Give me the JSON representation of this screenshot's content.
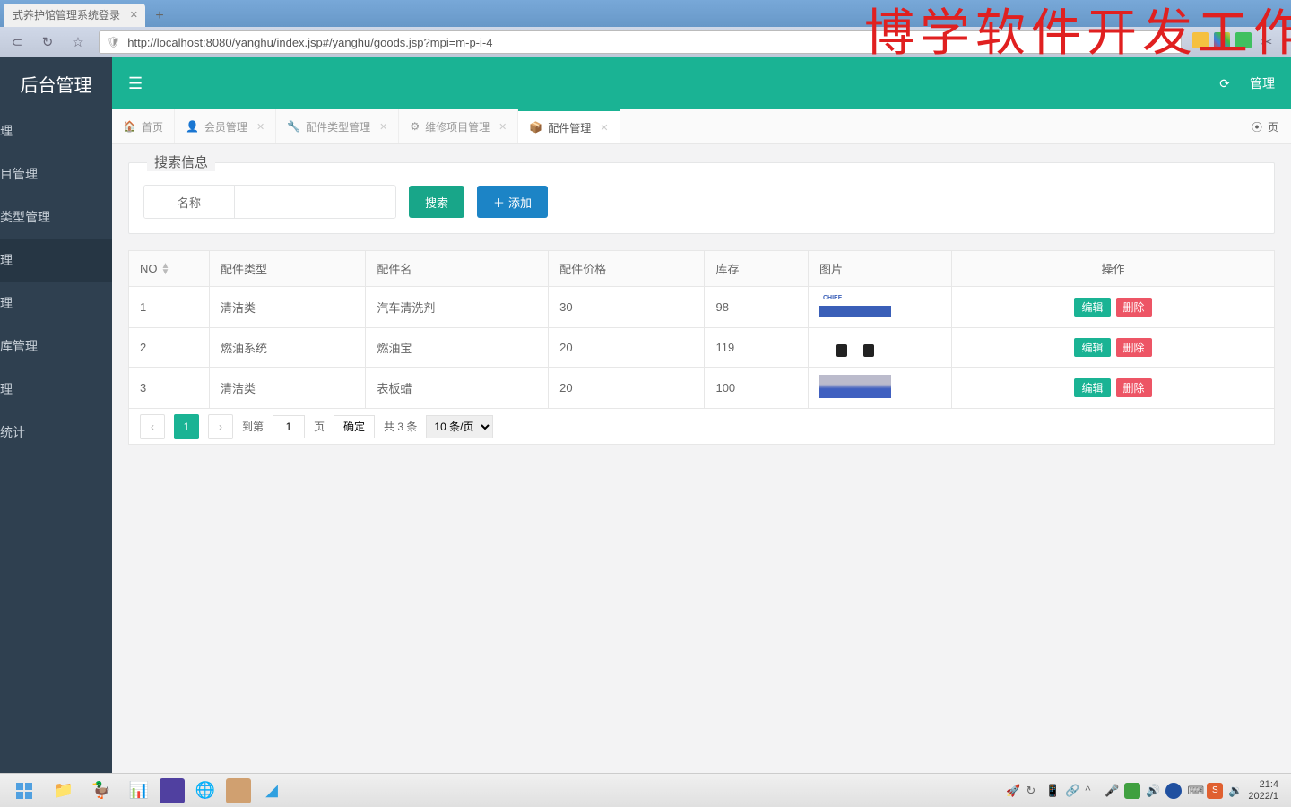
{
  "browser": {
    "tab_title": "式养护馆管理系统登录",
    "url": "http://localhost:8080/yanghu/index.jsp#/yanghu/goods.jsp?mpi=m-p-i-4"
  },
  "watermark": "博学软件开发工作",
  "sidebar": {
    "logo": "后台管理",
    "items": [
      {
        "label": "理"
      },
      {
        "label": "目管理"
      },
      {
        "label": "类型管理"
      },
      {
        "label": "理"
      },
      {
        "label": "理"
      },
      {
        "label": "库管理"
      },
      {
        "label": "理"
      },
      {
        "label": "统计"
      }
    ],
    "active": 3
  },
  "topbar": {
    "user": "管理",
    "refresh_icon": "refresh"
  },
  "tabs": [
    {
      "icon": "🏠",
      "label": "首页",
      "closable": false
    },
    {
      "icon": "👤",
      "label": "会员管理",
      "closable": true
    },
    {
      "icon": "🔧",
      "label": "配件类型管理",
      "closable": true
    },
    {
      "icon": "⚙",
      "label": "维修项目管理",
      "closable": true
    },
    {
      "icon": "📦",
      "label": "配件管理",
      "closable": true
    }
  ],
  "active_tab": 4,
  "tab_right": {
    "icon": "⦿",
    "label": "页"
  },
  "search": {
    "legend": "搜索信息",
    "name_label": "名称",
    "search_btn": "搜索",
    "add_btn": "添加"
  },
  "table": {
    "headers": [
      "NO",
      "配件类型",
      "配件名",
      "配件价格",
      "库存",
      "图片",
      "操作"
    ],
    "rows": [
      {
        "no": "1",
        "type": "清洁类",
        "name": "汽车清洗剂",
        "price": "30",
        "stock": "98",
        "img": "t1"
      },
      {
        "no": "2",
        "type": "燃油系统",
        "name": "燃油宝",
        "price": "20",
        "stock": "119",
        "img": "t2"
      },
      {
        "no": "3",
        "type": "清洁类",
        "name": "表板蜡",
        "price": "20",
        "stock": "100",
        "img": "t3"
      }
    ],
    "edit": "编辑",
    "del": "删除"
  },
  "pager": {
    "current": "1",
    "goto_pre": "到第",
    "goto_val": "1",
    "goto_post": "页",
    "confirm": "确定",
    "total": "共 3 条",
    "pagesize": "10 条/页"
  },
  "taskbar": {
    "time": "21:4",
    "date": "2022/1"
  }
}
